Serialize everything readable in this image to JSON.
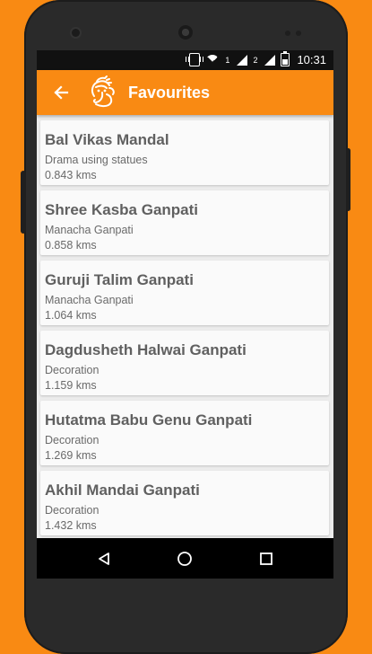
{
  "statusbar": {
    "sim1": "1",
    "sim2": "2",
    "time": "10:31"
  },
  "appbar": {
    "title": "Favourites",
    "accent": "#f98a13"
  },
  "list": [
    {
      "title": "Bal Vikas Mandal",
      "category": "Drama using statues",
      "distance": "0.843 kms"
    },
    {
      "title": "Shree Kasba Ganpati",
      "category": "Manacha Ganpati",
      "distance": "0.858 kms"
    },
    {
      "title": "Guruji Talim Ganpati",
      "category": "Manacha Ganpati",
      "distance": "1.064 kms"
    },
    {
      "title": "Dagdusheth Halwai Ganpati",
      "category": "Decoration",
      "distance": "1.159 kms"
    },
    {
      "title": "Hutatma Babu Genu Ganpati",
      "category": "Decoration",
      "distance": "1.269 kms"
    },
    {
      "title": "Akhil Mandai Ganpati",
      "category": "Decoration",
      "distance": "1.432 kms"
    }
  ],
  "icons": {
    "back": "arrow-back-icon",
    "logo": "ganpati-logo-icon",
    "nav_back": "triangle-back-icon",
    "nav_home": "circle-home-icon",
    "nav_recents": "square-recents-icon"
  }
}
